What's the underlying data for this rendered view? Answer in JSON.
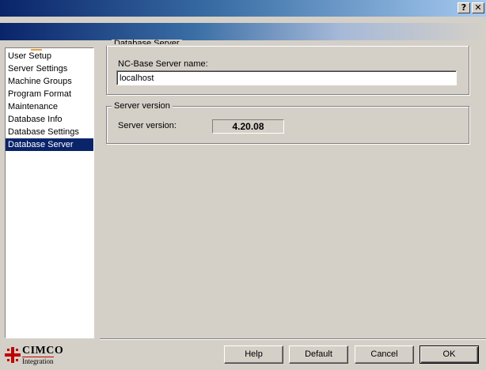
{
  "window": {
    "help_glyph": "?",
    "close_glyph": "✕"
  },
  "sidebar": {
    "items": [
      {
        "label": "User Setup",
        "selected": false
      },
      {
        "label": "Server Settings",
        "selected": false
      },
      {
        "label": "Machine Groups",
        "selected": false
      },
      {
        "label": "Program Format",
        "selected": false
      },
      {
        "label": "Maintenance",
        "selected": false
      },
      {
        "label": "Database Info",
        "selected": false
      },
      {
        "label": "Database Settings",
        "selected": false
      },
      {
        "label": "Database Server",
        "selected": true
      }
    ]
  },
  "server_group": {
    "legend": "Database Server",
    "name_label": "NC-Base Server name:",
    "name_value": "localhost"
  },
  "version_group": {
    "legend": "Server version",
    "label": "Server version:",
    "value": "4.20.08"
  },
  "buttons": {
    "help": "Help",
    "default": "Default",
    "cancel": "Cancel",
    "ok": "OK"
  },
  "logo": {
    "name": "CIMCO",
    "sub": "Integration"
  },
  "colors": {
    "selection": "#0a246a",
    "face": "#d4d0c8",
    "logo_red": "#c00000"
  }
}
